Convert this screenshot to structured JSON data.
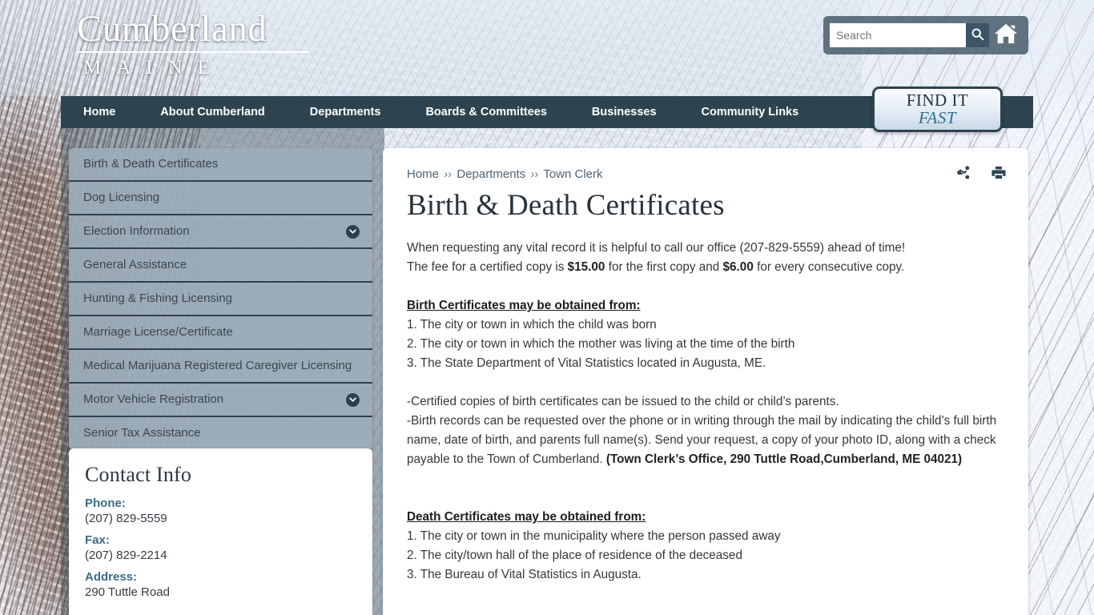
{
  "site": {
    "logo_word": "Cumberland",
    "logo_state": "MAINE"
  },
  "search": {
    "placeholder": "Search",
    "value": "",
    "search_icon": "search-icon",
    "home_icon": "home-icon"
  },
  "nav": {
    "items": [
      {
        "label": "Home"
      },
      {
        "label": "About Cumberland"
      },
      {
        "label": "Departments"
      },
      {
        "label": "Boards & Committees"
      },
      {
        "label": "Businesses"
      },
      {
        "label": "Community Links"
      }
    ]
  },
  "find_it_fast": {
    "line1": "FIND IT",
    "line2": "FAST"
  },
  "sidebar": {
    "items": [
      {
        "label": "Birth & Death Certificates",
        "expandable": false
      },
      {
        "label": "Dog Licensing",
        "expandable": false
      },
      {
        "label": "Election Information",
        "expandable": true
      },
      {
        "label": "General Assistance",
        "expandable": false
      },
      {
        "label": "Hunting & Fishing Licensing",
        "expandable": false
      },
      {
        "label": "Marriage License/Certificate",
        "expandable": false
      },
      {
        "label": "Medical Marijuana Registered Caregiver Licensing",
        "expandable": false
      },
      {
        "label": "Motor Vehicle Registration",
        "expandable": true
      },
      {
        "label": "Senior Tax Assistance",
        "expandable": false
      }
    ]
  },
  "contact": {
    "heading": "Contact Info",
    "phone_label": "Phone:",
    "phone_value": "(207) 829-5559",
    "fax_label": "Fax:",
    "fax_value": "(207) 829-2214",
    "address_label": "Address:",
    "address_value": "290 Tuttle Road"
  },
  "content": {
    "breadcrumb": [
      {
        "label": "Home"
      },
      {
        "label": "Departments"
      },
      {
        "label": "Town Clerk"
      }
    ],
    "breadcrumb_separator": "››",
    "title": "Birth & Death Certificates",
    "intro_line1": "When requesting any vital record it is helpful to call our office (207-829-5559) ahead of time!",
    "fee_pre": "The fee for a certified copy is ",
    "fee_first": "$15.00",
    "fee_mid": " for the first copy and ",
    "fee_second": "$6.00",
    "fee_post": " for every consecutive copy.",
    "birth_heading": "Birth Certificates may be obtained from:",
    "birth_items": [
      "1. The city or town in which the child was born",
      "2. The city or town in which the mother was living at the time of the birth",
      "3. The State Department of Vital Statistics located in Augusta, ME."
    ],
    "birth_note1": "-Certified copies of birth certificates can be issued to the child or child’s parents.",
    "birth_note2_pre": "-Birth records can be requested over the phone or in writing through the mail by indicating the child’s full birth name, date of birth, and parents full name(s). Send your request, a copy of your photo ID, along with a check payable to the Town of Cumberland. ",
    "birth_note2_bold": "(Town Clerk’s Office, 290 Tuttle Road,Cumberland, ME 04021)",
    "death_heading": "Death Certificates may be obtained from:",
    "death_items": [
      "1. The city or town in the municipality where the person passed away",
      "2. The city/town hall of the place of residence of the deceased",
      "3. The Bureau of Vital Statistics in Augusta."
    ],
    "share_icon": "share-icon",
    "print_icon": "print-icon"
  },
  "colors": {
    "nav_bar": "#2d4450",
    "sidebar_item": "#9cacb8",
    "sidebar_divider": "#2d4350",
    "accent_blue": "#3a6b8c",
    "title_dark": "#27323a",
    "find_it_fast_accent": "#2f6e96"
  }
}
